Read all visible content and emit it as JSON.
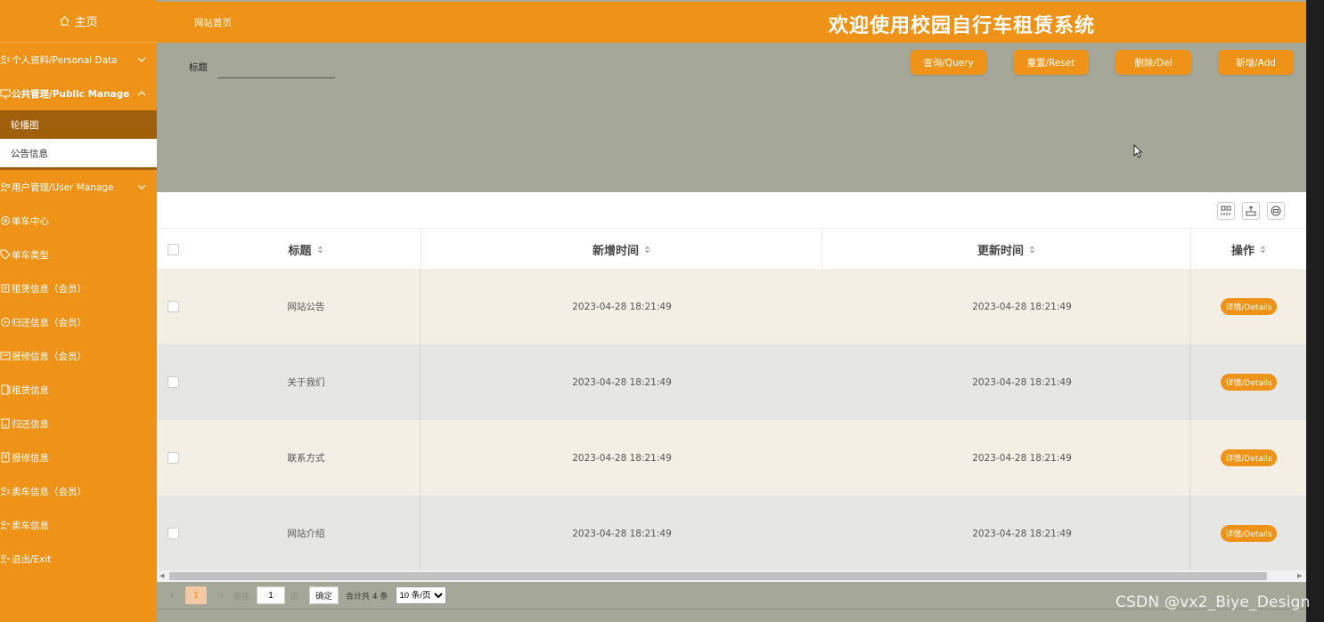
{
  "sidebar": {
    "home_label": "主页",
    "items": [
      {
        "label": "个人资料/Personal Data",
        "icon": "person-card-icon",
        "expandable": true,
        "open": false
      },
      {
        "label": "公共管理/Public Manage",
        "icon": "monitor-icon",
        "expandable": true,
        "open": true
      },
      {
        "label": "用户管理/User Manage",
        "icon": "users-icon",
        "expandable": true,
        "open": false
      },
      {
        "label": "单车中心",
        "icon": "bike-center-icon"
      },
      {
        "label": "单车类型",
        "icon": "tag-icon"
      },
      {
        "label": "租赁信息（会员）",
        "icon": "rent-icon"
      },
      {
        "label": "归还信息（会员）",
        "icon": "return-icon"
      },
      {
        "label": "报修信息（会员）",
        "icon": "repair-icon"
      },
      {
        "label": "租赁信息",
        "icon": "rent-doc-icon"
      },
      {
        "label": "归还信息",
        "icon": "return-doc-icon"
      },
      {
        "label": "报修信息",
        "icon": "repair-doc-icon"
      },
      {
        "label": "卖车信息（会员）",
        "icon": "sell-icon"
      },
      {
        "label": "卖车信息",
        "icon": "sell-doc-icon"
      },
      {
        "label": "退出/Exit",
        "icon": "exit-icon"
      }
    ],
    "public_manage_sub": [
      "轮播图",
      "公告信息"
    ]
  },
  "topbar": {
    "breadcrumb": "网站首页",
    "title": "欢迎使用校园自行车租赁系统"
  },
  "search": {
    "label": "标题",
    "value": "",
    "buttons": {
      "query": "查询/Query",
      "reset": "重置/Reset",
      "delete": "删除/Del",
      "add": "新增/Add"
    }
  },
  "toolbar": {
    "icons": [
      "columns-icon",
      "export-icon",
      "print-icon"
    ]
  },
  "table": {
    "columns": [
      "标题",
      "新增时间",
      "更新时间",
      "操作"
    ],
    "rows": [
      {
        "title": "网站公告",
        "created": "2023-04-28 18:21:49",
        "updated": "2023-04-28 18:21:49",
        "action": "详情/Details"
      },
      {
        "title": "关于我们",
        "created": "2023-04-28 18:21:49",
        "updated": "2023-04-28 18:21:49",
        "action": "详情/Details"
      },
      {
        "title": "联系方式",
        "created": "2023-04-28 18:21:49",
        "updated": "2023-04-28 18:21:49",
        "action": "详情/Details"
      },
      {
        "title": "网站介绍",
        "created": "2023-04-28 18:21:49",
        "updated": "2023-04-28 18:21:49",
        "action": "详情/Details"
      }
    ]
  },
  "pagination": {
    "current_page": "1",
    "goto_prefix": "前往",
    "goto_value": "1",
    "goto_suffix": "页",
    "confirm": "确定",
    "total": "合计共 4 条",
    "page_size": "10 条/页"
  },
  "watermark": "CSDN @vx2_Biye_Design",
  "colors": {
    "accent": "#ef9318",
    "sidebar_active": "#a05f0a",
    "content_bg": "#a5a898",
    "row_odd": "#f3efe5",
    "row_even": "#e6e6e4"
  }
}
